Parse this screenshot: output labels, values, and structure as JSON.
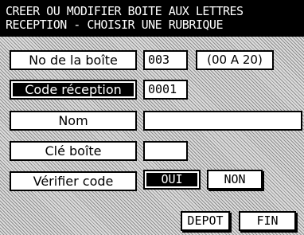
{
  "header": {
    "line1": "CREER OU MODIFIER BOITE AUX LETTRES",
    "line2": "RECEPTION - CHOISIR UNE RUBRIQUE"
  },
  "fields": {
    "box_number_label": "No de la boîte",
    "box_number_value": "003",
    "box_number_range": "(00 A 20)",
    "reception_code_label": "Code réception",
    "reception_code_value": "0001",
    "name_label": "Nom",
    "name_value": "",
    "box_key_label": "Clé boîte",
    "box_key_value": "",
    "verify_code_label": "Vérifier code",
    "verify_yes": "OUI",
    "verify_no": "NON"
  },
  "footer": {
    "depot_label": "DEPOT",
    "fin_label": "FIN"
  }
}
